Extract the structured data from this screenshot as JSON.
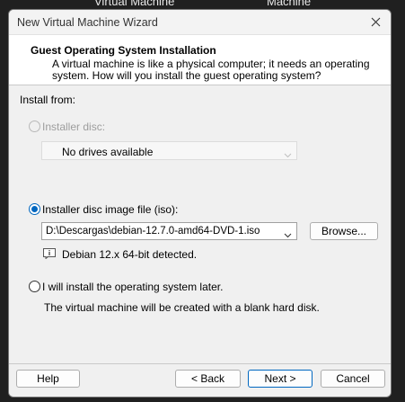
{
  "background": {
    "tab1": "Virtual Machine",
    "tab2": "Machine"
  },
  "window": {
    "title": "New Virtual Machine Wizard"
  },
  "header": {
    "title": "Guest Operating System Installation",
    "description": "A virtual machine is like a physical computer; it needs an operating system. How will you install the guest operating system?"
  },
  "install_from": {
    "label": "Install from:",
    "installer_disc": {
      "label": "Installer disc:",
      "selected": false,
      "enabled": false,
      "dropdown_value": "No drives available"
    },
    "iso": {
      "label": "Installer disc image file (iso):",
      "selected": true,
      "path": "D:\\Descargas\\debian-12.7.0-amd64-DVD-1.iso",
      "browse_label": "Browse...",
      "detected": "Debian 12.x 64-bit detected."
    },
    "later": {
      "label": "I will install the operating system later.",
      "selected": false,
      "note": "The virtual machine will be created with a blank hard disk."
    }
  },
  "footer": {
    "help": "Help",
    "back": "< Back",
    "next": "Next >",
    "cancel": "Cancel"
  },
  "colors": {
    "accent": "#0067c0",
    "window_bg": "#f0f0f0",
    "header_bg": "#ffffff",
    "disabled_text": "#9d9d9d",
    "desktop_bg": "#202020"
  },
  "icons": {
    "close": "close-icon",
    "chevron": "chevron-down-icon",
    "info": "info-icon"
  }
}
